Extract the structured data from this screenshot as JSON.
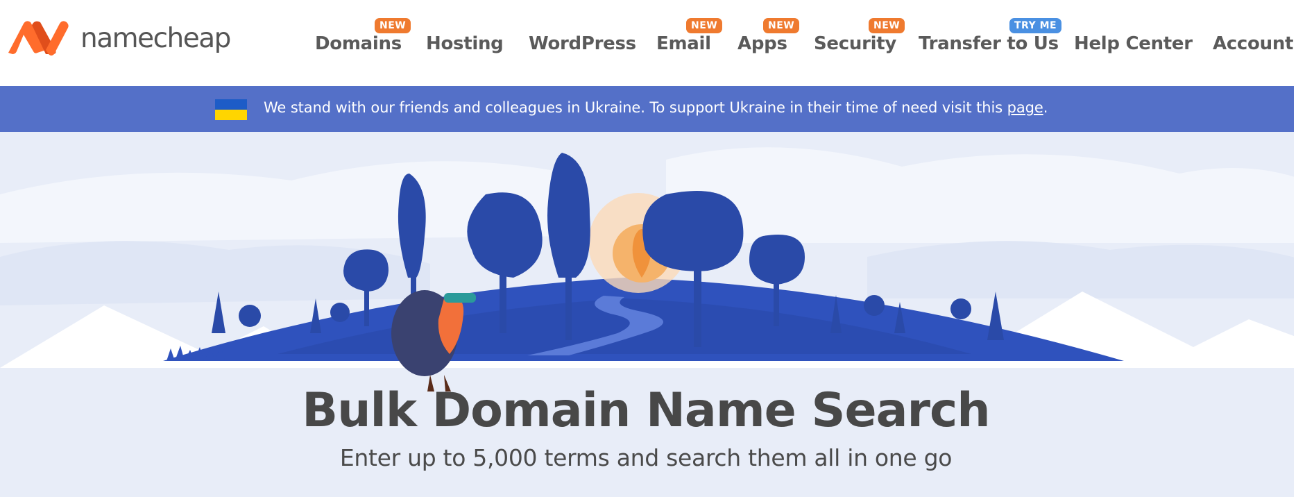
{
  "header": {
    "logo_text": "namecheap",
    "logo_colors": {
      "orange": "#ff6c2c",
      "dark_orange": "#e04e1b"
    },
    "nav": [
      {
        "label": "Domains",
        "badge": "NEW"
      },
      {
        "label": "Hosting",
        "badge": ""
      },
      {
        "label": "WordPress",
        "badge": ""
      },
      {
        "label": "Email",
        "badge": "NEW"
      },
      {
        "label": "Apps",
        "badge": "NEW"
      },
      {
        "label": "Security",
        "badge": "NEW"
      },
      {
        "label": "Transfer to Us",
        "badge": "TRY ME"
      },
      {
        "label": "Help Center",
        "badge": ""
      },
      {
        "label": "Account",
        "badge": ""
      }
    ]
  },
  "banner": {
    "text": "We stand with our friends and colleagues in Ukraine. To support Ukraine in their time of need visit this ",
    "link_text": "page",
    "suffix": ".",
    "background": "#5470c8",
    "flag_colors": [
      "#1d5cc7",
      "#ffd500"
    ]
  },
  "hero": {
    "title": "Bulk Domain Name Search",
    "subtitle": "Enter up to 5,000 terms and search them all in one go",
    "illustration": "hedgehog-with-binoculars-forest-sunrise"
  },
  "colors": {
    "badge_new": "#ef7a2f",
    "badge_try": "#4a90e2",
    "tree_blue": "#2a4aa8",
    "hill_blue": "#2f52bd",
    "sky": "#e8edf8"
  }
}
